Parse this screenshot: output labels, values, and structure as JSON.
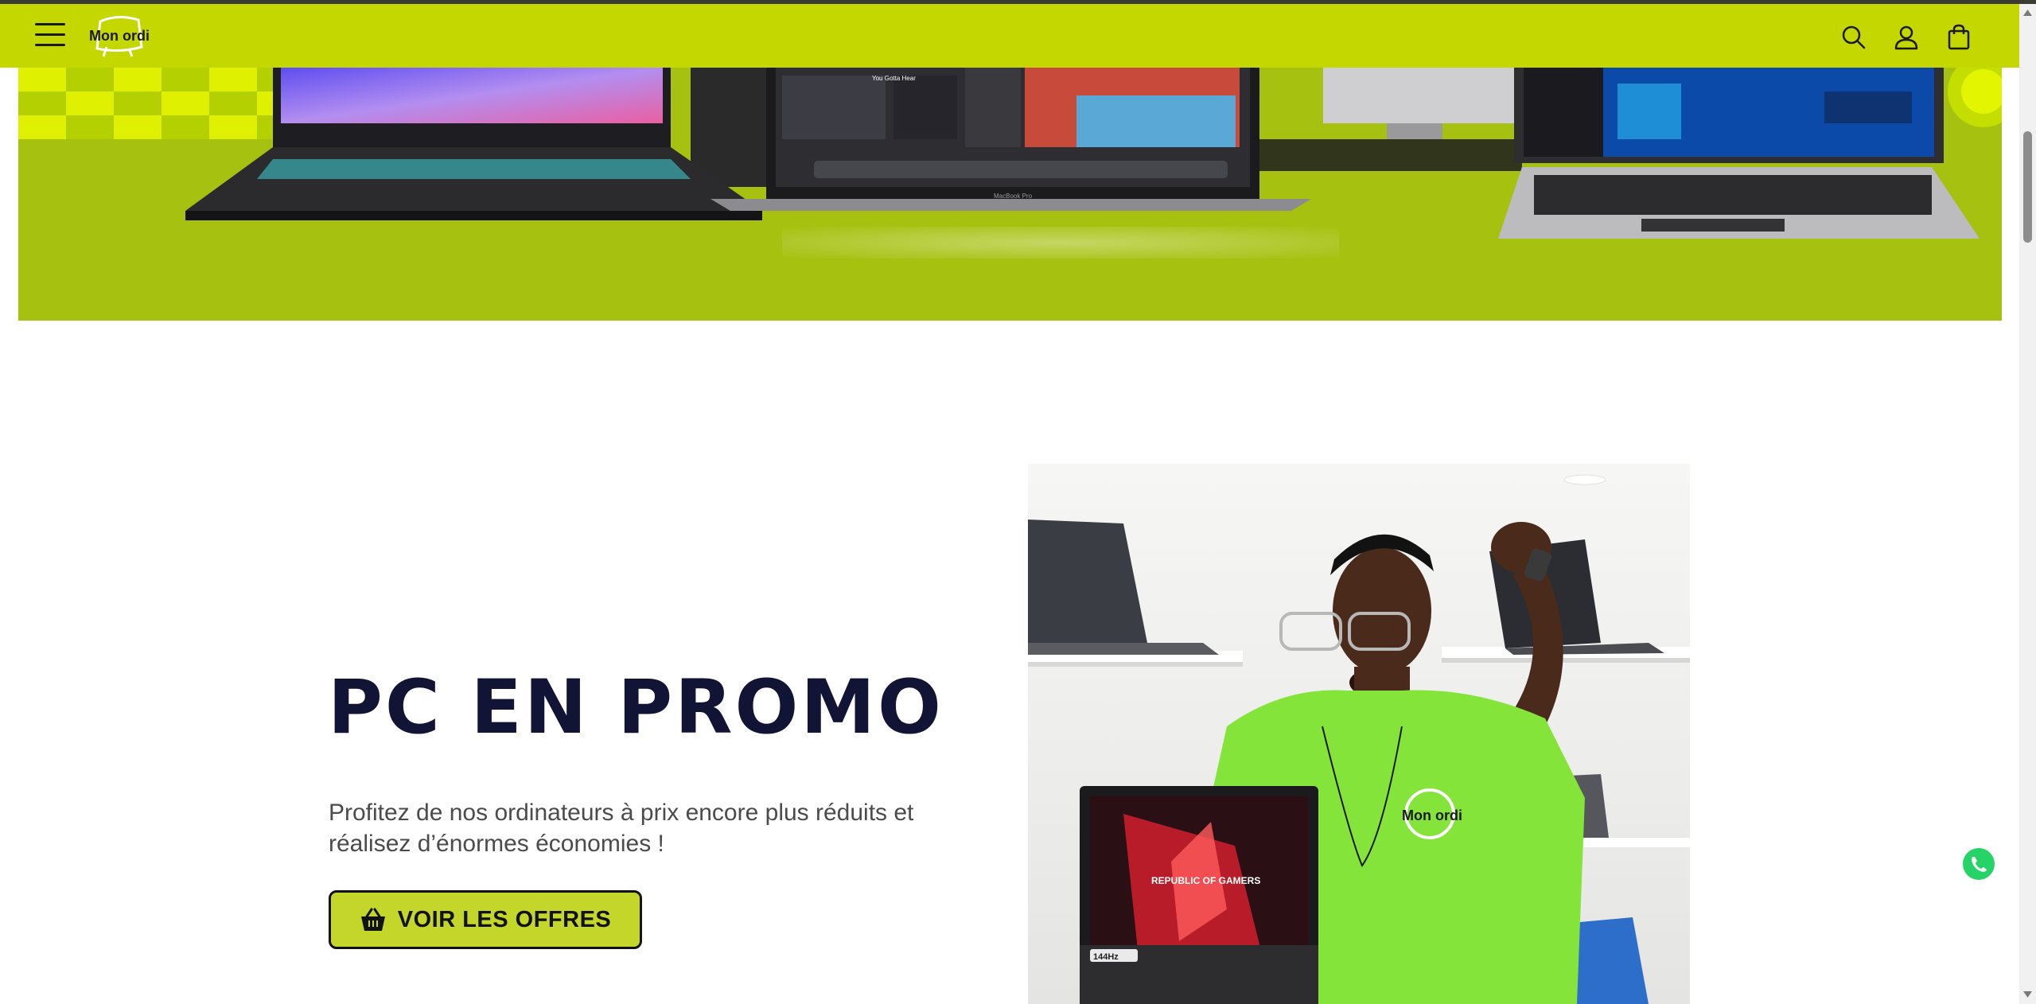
{
  "header": {
    "logo_text": "Mon ordi",
    "icons": [
      "menu-icon",
      "search-icon",
      "account-icon",
      "cart-icon"
    ]
  },
  "banner": {
    "laptop_label": "MacBook Pro",
    "screen_text": "You Gotta Hear"
  },
  "promo": {
    "title": "PC EN PROMO",
    "description": "Profitez de nos ordinateurs à prix encore plus réduits et réalisez d’énormes économies !",
    "cta_label": "VOIR LES OFFRES",
    "cta_icon": "basket-icon",
    "photo_texts": {
      "shirt_logo": "Mon ordi",
      "screen_brand": "REPUBLIC OF GAMERS",
      "refresh_rate": "144Hz"
    }
  },
  "colors": {
    "header_bg": "#c4d800",
    "banner_bg": "#a6c10f",
    "title_color": "#121435",
    "cta_bg": "#c4d62a"
  }
}
